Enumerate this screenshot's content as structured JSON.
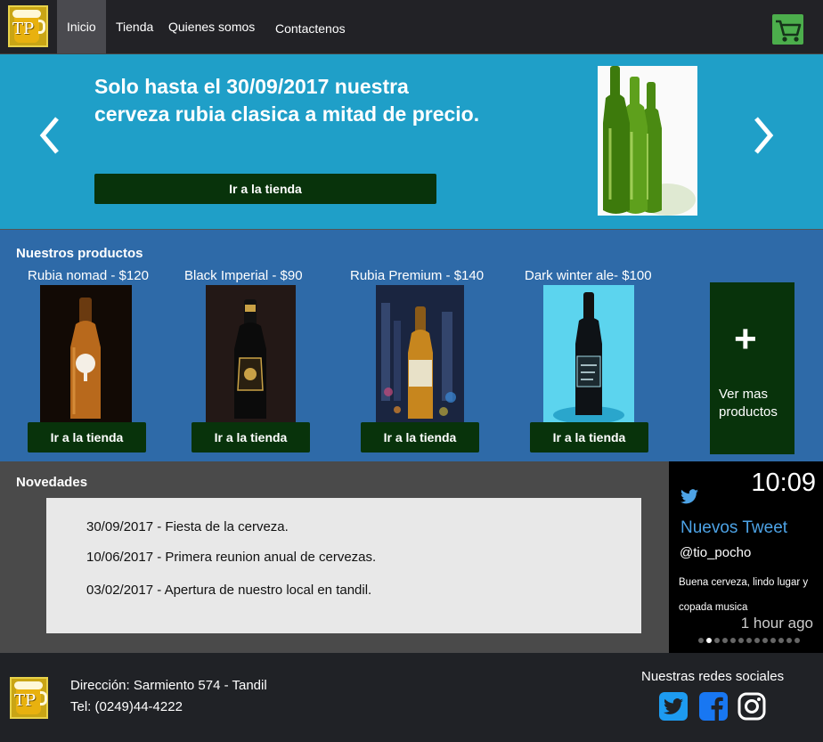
{
  "brand": {
    "logo_text": "TP"
  },
  "nav": {
    "items": [
      "Inicio",
      "Tienda",
      "Quienes somos",
      "Contactenos"
    ]
  },
  "hero": {
    "title": "Solo hasta el 30/09/2017 nuestra cerveza rubia clasica a mitad de precio.",
    "button": "Ir a la tienda"
  },
  "products": {
    "title": "Nuestros productos",
    "items": [
      {
        "name": "Rubia nomad - $120",
        "button": "Ir a la tienda"
      },
      {
        "name": "Black Imperial - $90",
        "button": "Ir a la tienda"
      },
      {
        "name": "Rubia Premium - $140",
        "button": "Ir a la tienda"
      },
      {
        "name": "Dark winter ale- $100",
        "button": "Ir a la tienda"
      }
    ],
    "more": {
      "plus": "+",
      "label": "Ver mas productos"
    }
  },
  "news": {
    "title": "Novedades",
    "items": [
      "30/09/2017 - Fiesta de la cerveza.",
      "10/06/2017 - Primera reunion anual de cervezas.",
      "03/02/2017 - Apertura de nuestro local en tandil."
    ]
  },
  "tweet": {
    "time": "10:09",
    "header": "Nuevos Tweet",
    "user": "@tio_pocho",
    "text": "Buena cerveza, lindo lugar y copada musica",
    "ago": "1 hour ago"
  },
  "footer": {
    "address": "Dirección: Sarmiento 574 - Tandil",
    "phone": "Tel: (0249)44-4222",
    "social_title": "Nuestras redes sociales"
  },
  "icons": {
    "cart": "shopping-cart-icon",
    "prev": "chevron-left-icon",
    "next": "chevron-right-icon",
    "twitter": "twitter-icon",
    "facebook": "facebook-icon",
    "instagram": "instagram-icon"
  },
  "colors": {
    "hero_bg": "#1f9fc8",
    "products_bg": "#2e6aa8",
    "button_green": "#08330b",
    "cart_green": "#4cae4c",
    "social_blue": "#1d9bf0"
  }
}
